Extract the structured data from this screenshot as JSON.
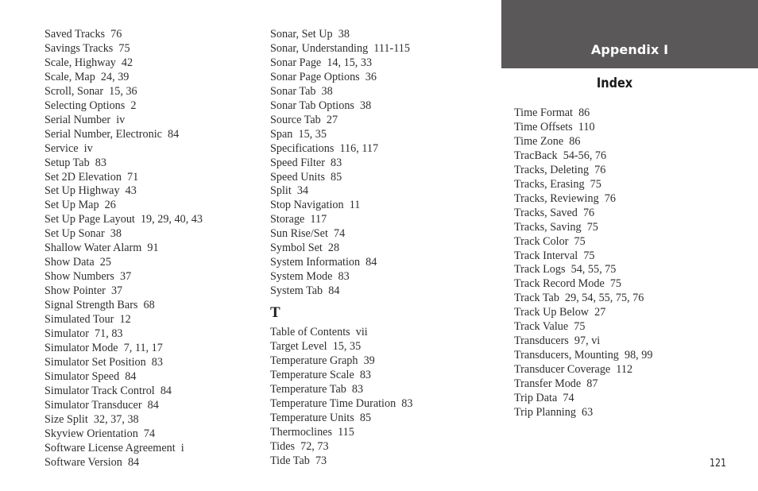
{
  "header": {
    "section": "Appendix I",
    "title": "Index",
    "band_color": "#5a5859"
  },
  "page_number": "121",
  "columns": [
    {
      "entries": [
        "Saved Tracks  76",
        "Savings Tracks  75",
        "Scale, Highway  42",
        "Scale, Map  24, 39",
        "Scroll, Sonar  15, 36",
        "Selecting Options  2",
        "Serial Number  iv",
        "Serial Number, Electronic  84",
        "Service  iv",
        "Setup Tab  83",
        "Set 2D Elevation  71",
        "Set Up Highway  43",
        "Set Up Map  26",
        "Set Up Page Layout  19, 29, 40, 43",
        "Set Up Sonar  38",
        "Shallow Water Alarm  91",
        "Show Data  25",
        "Show Numbers  37",
        "Show Pointer  37",
        "Signal Strength Bars  68",
        "Simulated Tour  12",
        "Simulator  71, 83",
        "Simulator Mode  7, 11, 17",
        "Simulator Set Position  83",
        "Simulator Speed  84",
        "Simulator Track Control  84",
        "Simulator Transducer  84",
        "Size Split  32, 37, 38",
        "Skyview Orientation  74",
        "Software License Agreement  i",
        "Software Version  84"
      ]
    },
    {
      "entries_before": [
        "Sonar, Set Up  38",
        "Sonar, Understanding  111-115",
        "Sonar Page  14, 15, 33",
        "Sonar Page Options  36",
        "Sonar Tab  38",
        "Sonar Tab Options  38",
        "Source Tab  27",
        "Span  15, 35",
        "Specifications  116, 117",
        "Speed Filter  83",
        "Speed Units  85",
        "Split  34",
        "Stop Navigation  11",
        "Storage  117",
        "Sun Rise/Set  74",
        "Symbol Set  28",
        "System Information  84",
        "System Mode  83",
        "System Tab  84"
      ],
      "letter_heading": "T",
      "entries_after": [
        "Table of Contents  vii",
        "Target Level  15, 35",
        "Temperature Graph  39",
        "Temperature Scale  83",
        "Temperature Tab  83",
        "Temperature Time Duration  83",
        "Temperature Units  85",
        "Thermoclines  115",
        "Tides  72, 73",
        "Tide Tab  73"
      ]
    },
    {
      "entries": [
        "Time Format  86",
        "Time Offsets  110",
        "Time Zone  86",
        "TracBack  54-56, 76",
        "Tracks, Deleting  76",
        "Tracks, Erasing  75",
        "Tracks, Reviewing  76",
        "Tracks, Saved  76",
        "Tracks, Saving  75",
        "Track Color  75",
        "Track Interval  75",
        "Track Logs  54, 55, 75",
        "Track Record Mode  75",
        "Track Tab  29, 54, 55, 75, 76",
        "Track Up Below  27",
        "Track Value  75",
        "Transducers  97, vi",
        "Transducers, Mounting  98, 99",
        "Transducer Coverage  112",
        "Transfer Mode  87",
        "Trip Data  74",
        "Trip Planning  63"
      ]
    }
  ]
}
